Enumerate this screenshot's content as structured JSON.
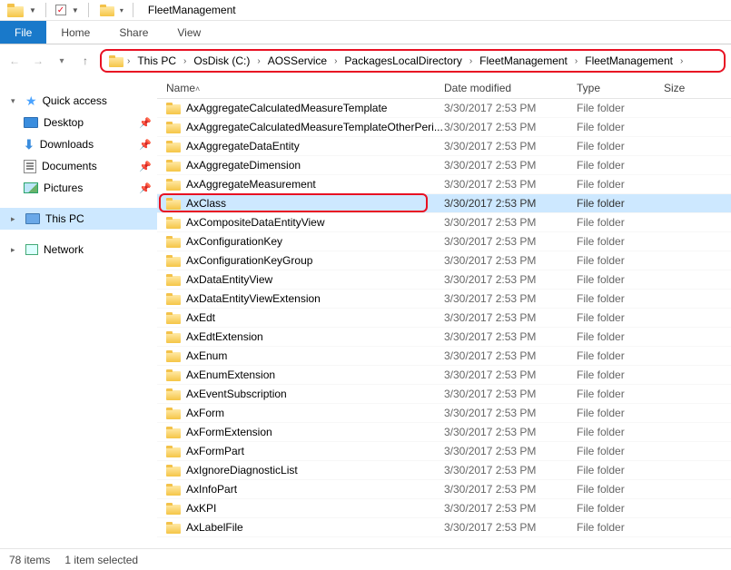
{
  "window": {
    "title": "FleetManagement"
  },
  "ribbon": {
    "file": "File",
    "tabs": [
      "Home",
      "Share",
      "View"
    ]
  },
  "breadcrumbs": [
    "This PC",
    "OsDisk (C:)",
    "AOSService",
    "PackagesLocalDirectory",
    "FleetManagement",
    "FleetManagement"
  ],
  "columns": {
    "name": "Name",
    "date": "Date modified",
    "type": "Type",
    "size": "Size"
  },
  "nav": {
    "quick": "Quick access",
    "items": [
      {
        "label": "Desktop",
        "pin": true
      },
      {
        "label": "Downloads",
        "pin": true
      },
      {
        "label": "Documents",
        "pin": true
      },
      {
        "label": "Pictures",
        "pin": true
      }
    ],
    "thispc": "This PC",
    "network": "Network"
  },
  "files": [
    {
      "name": "AxAggregateCalculatedMeasureTemplate",
      "date": "3/30/2017 2:53 PM",
      "type": "File folder",
      "sel": false
    },
    {
      "name": "AxAggregateCalculatedMeasureTemplateOtherPeri...",
      "date": "3/30/2017 2:53 PM",
      "type": "File folder",
      "sel": false
    },
    {
      "name": "AxAggregateDataEntity",
      "date": "3/30/2017 2:53 PM",
      "type": "File folder",
      "sel": false
    },
    {
      "name": "AxAggregateDimension",
      "date": "3/30/2017 2:53 PM",
      "type": "File folder",
      "sel": false
    },
    {
      "name": "AxAggregateMeasurement",
      "date": "3/30/2017 2:53 PM",
      "type": "File folder",
      "sel": false
    },
    {
      "name": "AxClass",
      "date": "3/30/2017 2:53 PM",
      "type": "File folder",
      "sel": true
    },
    {
      "name": "AxCompositeDataEntityView",
      "date": "3/30/2017 2:53 PM",
      "type": "File folder",
      "sel": false
    },
    {
      "name": "AxConfigurationKey",
      "date": "3/30/2017 2:53 PM",
      "type": "File folder",
      "sel": false
    },
    {
      "name": "AxConfigurationKeyGroup",
      "date": "3/30/2017 2:53 PM",
      "type": "File folder",
      "sel": false
    },
    {
      "name": "AxDataEntityView",
      "date": "3/30/2017 2:53 PM",
      "type": "File folder",
      "sel": false
    },
    {
      "name": "AxDataEntityViewExtension",
      "date": "3/30/2017 2:53 PM",
      "type": "File folder",
      "sel": false
    },
    {
      "name": "AxEdt",
      "date": "3/30/2017 2:53 PM",
      "type": "File folder",
      "sel": false
    },
    {
      "name": "AxEdtExtension",
      "date": "3/30/2017 2:53 PM",
      "type": "File folder",
      "sel": false
    },
    {
      "name": "AxEnum",
      "date": "3/30/2017 2:53 PM",
      "type": "File folder",
      "sel": false
    },
    {
      "name": "AxEnumExtension",
      "date": "3/30/2017 2:53 PM",
      "type": "File folder",
      "sel": false
    },
    {
      "name": "AxEventSubscription",
      "date": "3/30/2017 2:53 PM",
      "type": "File folder",
      "sel": false
    },
    {
      "name": "AxForm",
      "date": "3/30/2017 2:53 PM",
      "type": "File folder",
      "sel": false
    },
    {
      "name": "AxFormExtension",
      "date": "3/30/2017 2:53 PM",
      "type": "File folder",
      "sel": false
    },
    {
      "name": "AxFormPart",
      "date": "3/30/2017 2:53 PM",
      "type": "File folder",
      "sel": false
    },
    {
      "name": "AxIgnoreDiagnosticList",
      "date": "3/30/2017 2:53 PM",
      "type": "File folder",
      "sel": false
    },
    {
      "name": "AxInfoPart",
      "date": "3/30/2017 2:53 PM",
      "type": "File folder",
      "sel": false
    },
    {
      "name": "AxKPI",
      "date": "3/30/2017 2:53 PM",
      "type": "File folder",
      "sel": false
    },
    {
      "name": "AxLabelFile",
      "date": "3/30/2017 2:53 PM",
      "type": "File folder",
      "sel": false
    }
  ],
  "status": {
    "count": "78 items",
    "selected": "1 item selected"
  }
}
